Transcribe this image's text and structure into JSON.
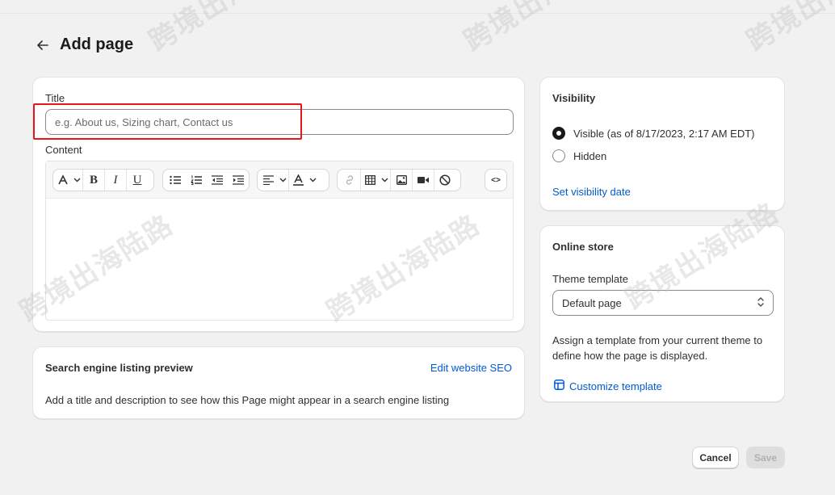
{
  "header": {
    "back_icon": "arrow-left-icon",
    "title": "Add page"
  },
  "content_card": {
    "title_label": "Title",
    "title_value": "",
    "title_placeholder": "e.g. About us, Sizing chart, Contact us",
    "content_label": "Content",
    "toolbar": {
      "font_icon": "text-style-icon",
      "bold_label": "B",
      "italic_label": "I",
      "underline_label": "U",
      "buttons": [
        "bulleted-list",
        "numbered-list",
        "outdent",
        "indent",
        "align-left",
        "text-color",
        "link",
        "table",
        "image",
        "video",
        "clear-format",
        "show-html"
      ],
      "html_label": "<>"
    }
  },
  "seo_card": {
    "title": "Search engine listing preview",
    "link": "Edit website SEO",
    "description": "Add a title and description to see how this Page might appear in a search engine listing"
  },
  "visibility_card": {
    "title": "Visibility",
    "options": [
      {
        "label": "Visible (as of 8/17/2023, 2:17 AM EDT)",
        "selected": true
      },
      {
        "label": "Hidden",
        "selected": false
      }
    ],
    "link": "Set visibility date"
  },
  "online_store_card": {
    "title": "Online store",
    "template_label": "Theme template",
    "template_value": "Default page",
    "help_text": "Assign a template from your current theme to define how the page is displayed.",
    "customize_link": "Customize template"
  },
  "actions": {
    "cancel": "Cancel",
    "save": "Save",
    "save_disabled": true
  },
  "watermark": "跨境出海陆路",
  "colors": {
    "link": "#005bd3",
    "highlight": "#e5171c",
    "background": "#f1f1f1"
  }
}
